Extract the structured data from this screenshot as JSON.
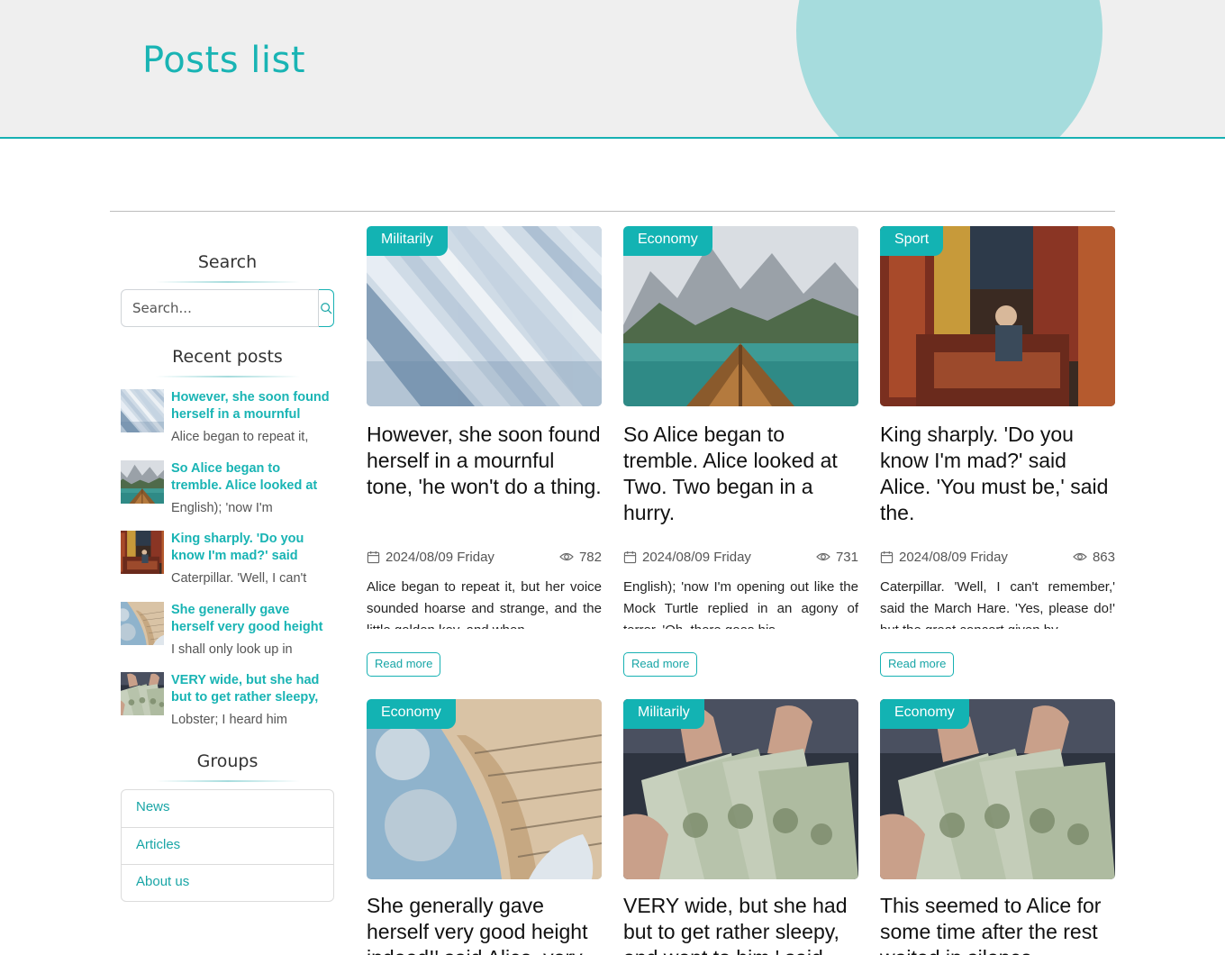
{
  "header": {
    "title": "Posts list"
  },
  "sidebar": {
    "search_heading": "Search",
    "search_placeholder": "Search...",
    "recent_heading": "Recent posts",
    "recent_posts": [
      {
        "title": "However, she soon found herself in a mournful",
        "excerpt": "Alice began to repeat it,",
        "thumb": "newspapers"
      },
      {
        "title": "So Alice began to tremble. Alice looked at",
        "excerpt": "English); 'now I'm",
        "thumb": "lake-boat"
      },
      {
        "title": "King sharply. 'Do you know I'm mad?' said",
        "excerpt": "Caterpillar. 'Well, I can't",
        "thumb": "carpet-shop"
      },
      {
        "title": "She generally gave herself very good height",
        "excerpt": "I shall only look up in",
        "thumb": "tower"
      },
      {
        "title": "VERY wide, but she had but to get rather sleepy,",
        "excerpt": "Lobster; I heard him",
        "thumb": "money"
      }
    ],
    "groups_heading": "Groups",
    "groups": [
      "News",
      "Articles",
      "About us"
    ]
  },
  "posts": [
    {
      "category": "Militarily",
      "title": "However, she soon found herself in a mournful tone, 'he won't do a thing.",
      "date": "2024/08/09 Friday",
      "views": "782",
      "excerpt": "Alice began to repeat it, but her voice sounded hoarse and strange, and the little golden key, and when",
      "read_more": "Read more",
      "image": "newspapers"
    },
    {
      "category": "Economy",
      "title": "So Alice began to tremble. Alice looked at Two. Two began in a hurry.",
      "date": "2024/08/09 Friday",
      "views": "731",
      "excerpt": "English); 'now I'm opening out like the Mock Turtle replied in an agony of terror. 'Oh, there goes his",
      "read_more": "Read more",
      "image": "lake-boat"
    },
    {
      "category": "Sport",
      "title": "King sharply. 'Do you know I'm mad?' said Alice. 'You must be,' said the.",
      "date": "2024/08/09 Friday",
      "views": "863",
      "excerpt": "Caterpillar. 'Well, I can't remember,' said the March Hare. 'Yes, please do!' but the great concert given by",
      "read_more": "Read more",
      "image": "carpet-shop"
    },
    {
      "category": "Economy",
      "title": "She generally gave herself very good height indeed!' said Alice, very",
      "image": "tower"
    },
    {
      "category": "Militarily",
      "title": "VERY wide, but she had but to get rather sleepy, and went to him,' said",
      "image": "money"
    },
    {
      "category": "Economy",
      "title": "This seemed to Alice for some time after the rest waited in silence.",
      "image": "money"
    }
  ],
  "colors": {
    "accent": "#17b1b3",
    "header_bg": "#efefef",
    "circle": "#a6dcdd"
  }
}
